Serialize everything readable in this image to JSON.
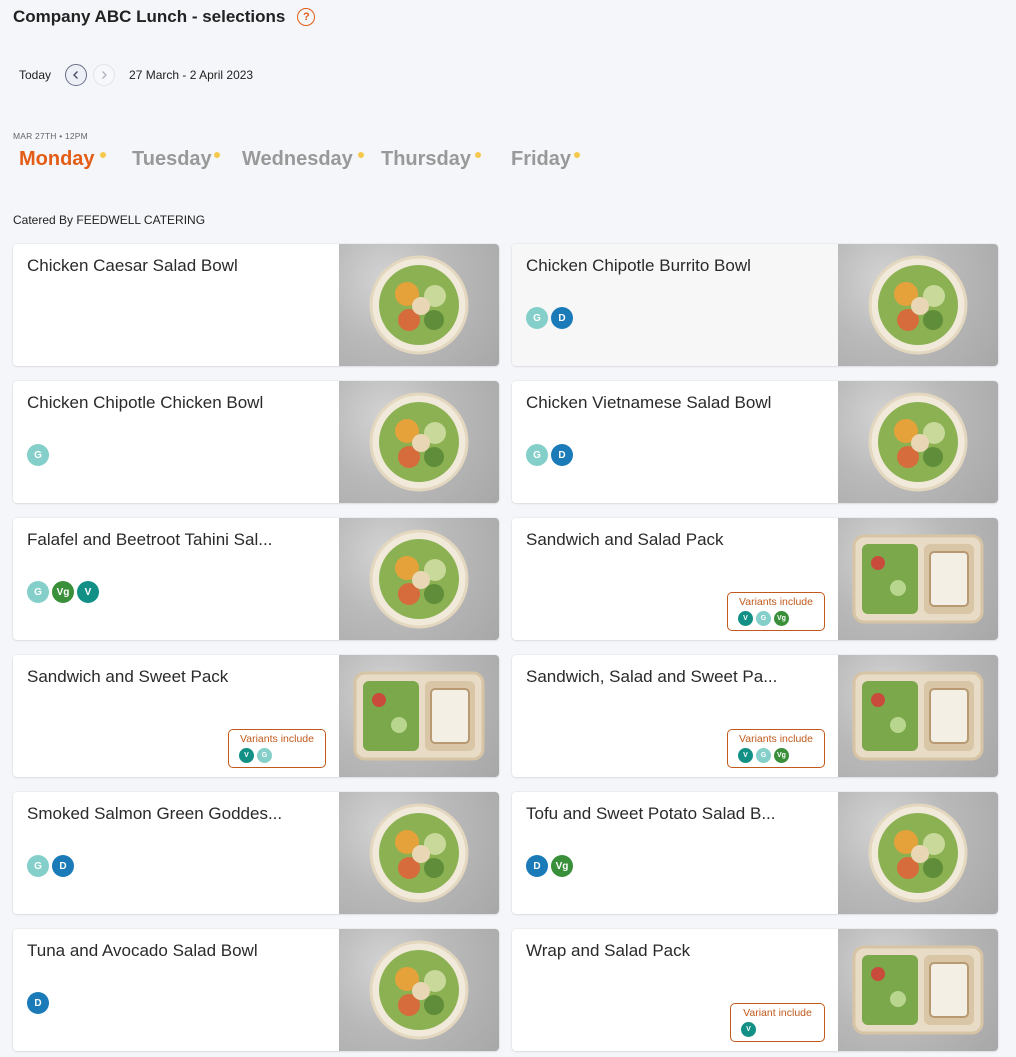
{
  "header": {
    "title": "Company ABC Lunch - selections",
    "help_icon": "help-circle-icon"
  },
  "date_nav": {
    "today_label": "Today",
    "range": "27 March - 2 April 2023"
  },
  "day_meta": "MAR 27TH • 12PM",
  "days": [
    "Monday",
    "Tuesday",
    "Wednesday",
    "Thursday",
    "Friday"
  ],
  "active_day": "Monday",
  "caterer": "Catered By FEEDWELL CATERING",
  "colors": {
    "accent": "#e35d16",
    "tag_G": "#84cfc9",
    "tag_D": "#1a7bb8",
    "tag_V": "#129086",
    "tag_Vg": "#3a8f3b"
  },
  "meals": [
    {
      "name": "Chicken Caesar Salad Bowl",
      "tags": [],
      "photo": "bowl"
    },
    {
      "name": "Chicken Chipotle Burrito Bowl",
      "tags": [
        "G",
        "D"
      ],
      "photo": "bowl"
    },
    {
      "name": "Chicken Chipotle Chicken Bowl",
      "tags": [
        "G"
      ],
      "photo": "bowl"
    },
    {
      "name": "Chicken Vietnamese Salad Bowl",
      "tags": [
        "G",
        "D"
      ],
      "photo": "bowl"
    },
    {
      "name": "Falafel and Beetroot Tahini Sal...",
      "tags": [
        "G",
        "Vg",
        "V"
      ],
      "photo": "bowl"
    },
    {
      "name": "Sandwich and Salad Pack",
      "tags": [],
      "variants_label": "Variants include",
      "variants": [
        "V",
        "G",
        "Vg"
      ],
      "photo": "tray"
    },
    {
      "name": "Sandwich and Sweet Pack",
      "tags": [],
      "variants_label": "Variants include",
      "variants": [
        "V",
        "G"
      ],
      "photo": "tray"
    },
    {
      "name": "Sandwich, Salad and Sweet Pa...",
      "tags": [],
      "variants_label": "Variants include",
      "variants": [
        "V",
        "G",
        "Vg"
      ],
      "photo": "tray"
    },
    {
      "name": "Smoked Salmon Green Goddes...",
      "tags": [
        "G",
        "D"
      ],
      "photo": "bowl"
    },
    {
      "name": "Tofu and Sweet Potato Salad B...",
      "tags": [
        "D",
        "Vg"
      ],
      "photo": "bowl"
    },
    {
      "name": "Tuna and Avocado Salad Bowl",
      "tags": [
        "D"
      ],
      "photo": "bowl"
    },
    {
      "name": "Wrap and Salad Pack",
      "tags": [],
      "variants_label": "Variant include",
      "variants": [
        "V"
      ],
      "photo": "tray"
    }
  ]
}
